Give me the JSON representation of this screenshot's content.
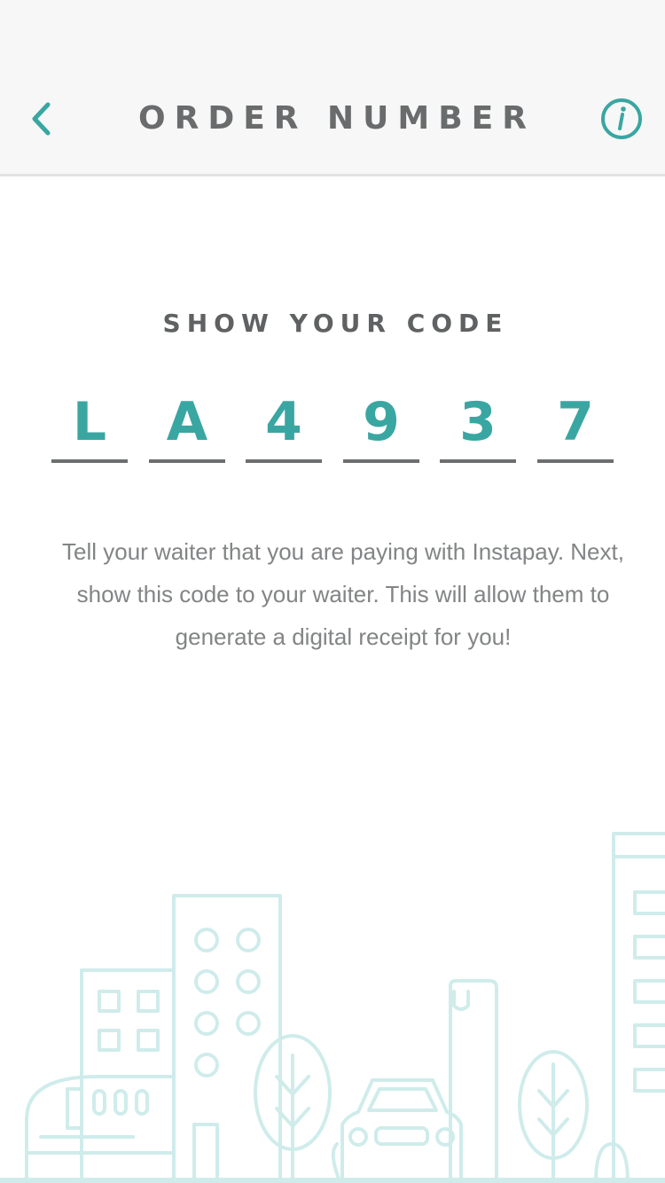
{
  "header": {
    "title": "ORDER NUMBER",
    "back_icon": "chevron-left-icon",
    "info_icon": "info-icon"
  },
  "main": {
    "subtitle": "SHOW YOUR CODE",
    "code": [
      "L",
      "A",
      "4",
      "9",
      "3",
      "7"
    ],
    "instructions": "Tell your waiter that you are paying with Instapay. Next, show this code to your waiter. This will allow them to generate a digital receipt for you!"
  },
  "colors": {
    "accent": "#3aa6a2",
    "header_bg": "#f6f7f6",
    "title_text": "#696b6c",
    "body_text": "#828485",
    "illustration": "#cfeceb"
  }
}
